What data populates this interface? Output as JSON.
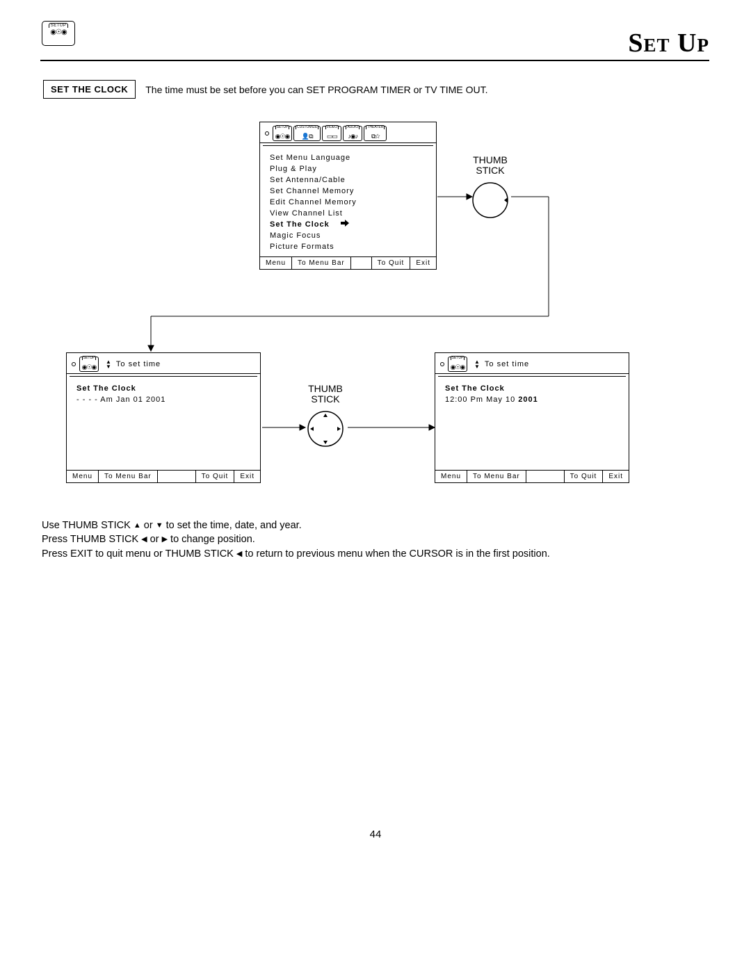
{
  "page_title": "Set Up",
  "setup_tab_label": "SETUP",
  "heading": {
    "box": "SET THE CLOCK",
    "desc": "The time must be set before you can  SET PROGRAM TIMER or TV TIME OUT."
  },
  "thumb_label": "THUMB\nSTICK",
  "tabs": {
    "setup": "SETUP",
    "customize": "CUSTOMIZE",
    "video": "VIDEO",
    "audio": "AUDIO",
    "theater": "THEATER"
  },
  "top_menu": {
    "items": [
      "Set Menu Language",
      "Plug & Play",
      "Set Antenna/Cable",
      "Set Channel Memory",
      "Edit Channel Memory",
      "View Channel List",
      "Set The Clock",
      "Magic Focus",
      "Picture Formats"
    ],
    "selected_index": 6
  },
  "clock_panel_header": "To set time",
  "clock_title": "Set The Clock",
  "clock_left_value": "- -  - - Am Jan 01 2001",
  "clock_right_value_main": "12:00 Pm May 10 ",
  "clock_right_value_bold": "2001",
  "footer": {
    "menu": "Menu",
    "to_menu_bar": "To Menu Bar",
    "to_quit": "To Quit",
    "exit": "Exit"
  },
  "instructions": {
    "l1a": "Use THUMB STICK ",
    "l1b": " or ",
    "l1c": " to set the time, date, and year.",
    "l2a": "Press THUMB STICK ",
    "l2b": " or ",
    "l2c": " to change position.",
    "l3a": "Press EXIT to quit menu or THUMB STICK ",
    "l3b": " to return to previous menu when the CURSOR is in the first position."
  },
  "page_number": "44"
}
